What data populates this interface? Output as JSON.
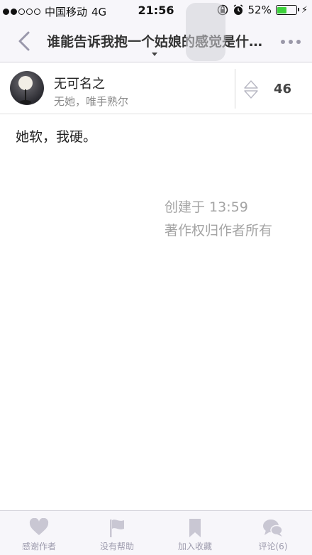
{
  "status_bar": {
    "carrier": "中国移动",
    "network": "4G",
    "time": "21:56",
    "battery_percent": "52%",
    "battery_level": 0.52,
    "signal_bars": 2,
    "icons": [
      "rotation-lock-icon",
      "alarm-icon",
      "charging-bolt-icon"
    ]
  },
  "nav": {
    "title": "谁能告诉我抱一个姑娘的感觉是什么样的？",
    "back_icon": "chevron-left-icon",
    "more_icon": "more-dots-icon"
  },
  "author": {
    "name": "无可名之",
    "bio": "无她，唯手熟尔",
    "vote_count": "46"
  },
  "answer": {
    "body": "她软，我硬。",
    "created": "创建于 13:59",
    "copyright": "著作权归作者所有"
  },
  "toolbar": {
    "items": [
      {
        "label": "感谢作者",
        "icon": "heart-icon"
      },
      {
        "label": "没有帮助",
        "icon": "flag-icon"
      },
      {
        "label": "加入收藏",
        "icon": "bookmark-icon"
      },
      {
        "label": "评论(6)",
        "icon": "comment-icon"
      }
    ]
  },
  "colors": {
    "bar_background": "#f7f6fa",
    "icon_gray": "#c9c7d3",
    "battery_green": "#3dd13b",
    "meta_text": "#a4a4a4"
  }
}
